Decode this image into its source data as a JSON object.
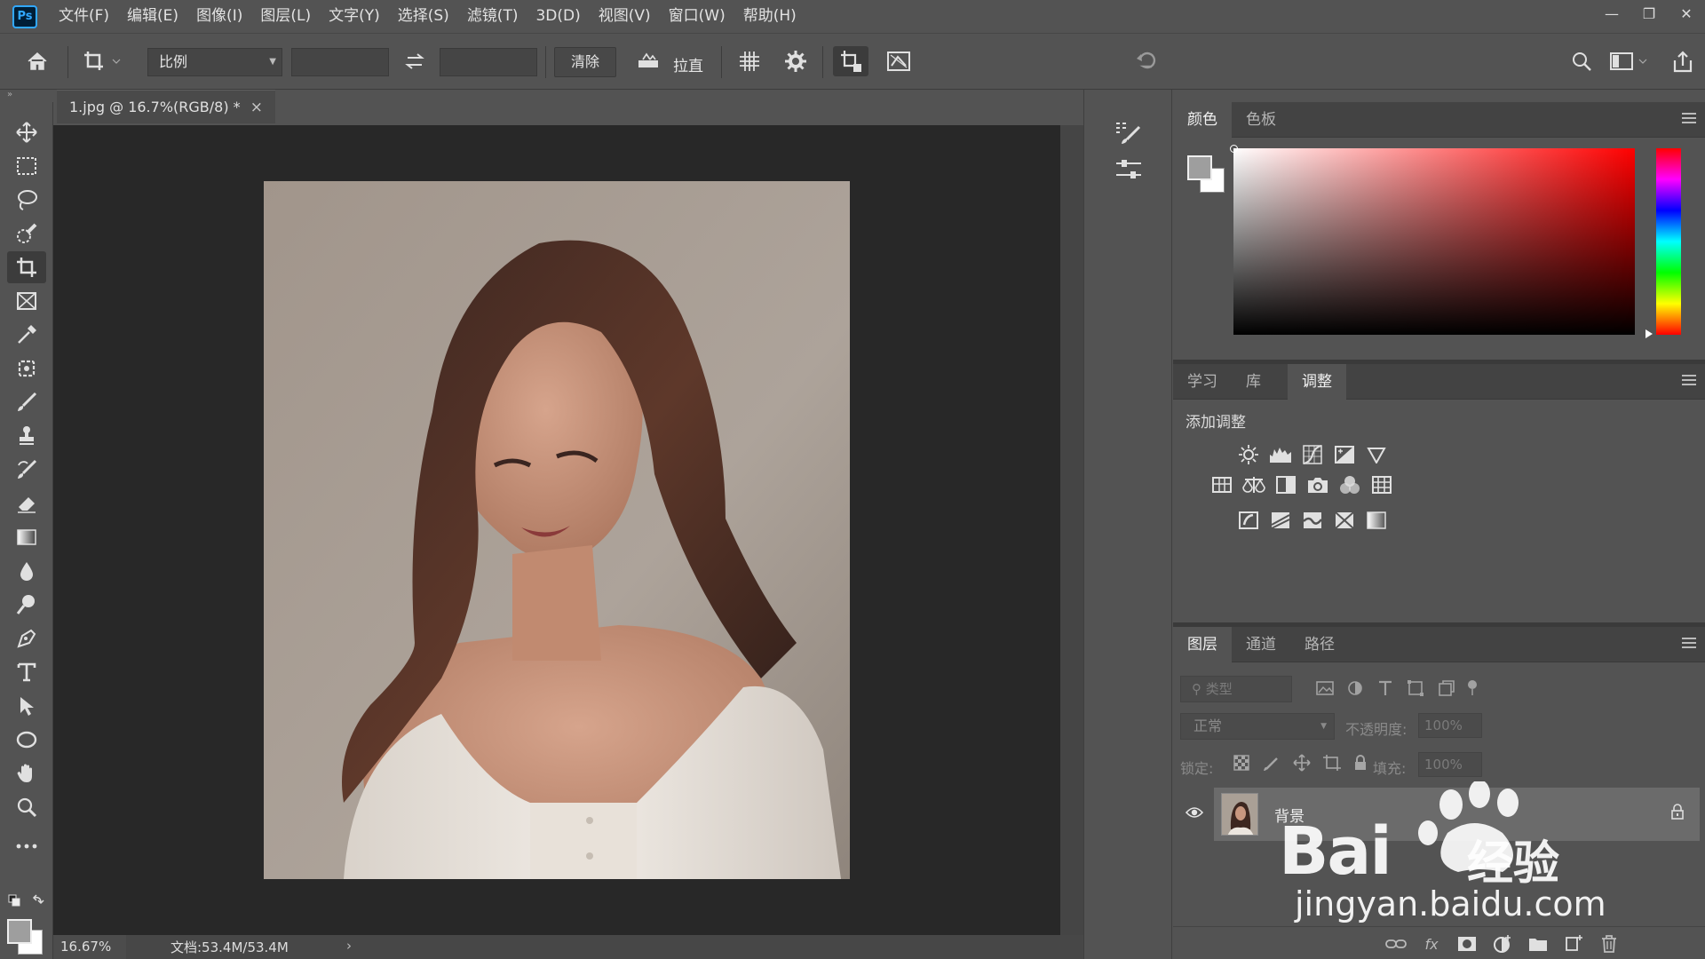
{
  "app": {
    "logo": "Ps"
  },
  "menu": [
    "文件(F)",
    "编辑(E)",
    "图像(I)",
    "图层(L)",
    "文字(Y)",
    "选择(S)",
    "滤镜(T)",
    "3D(D)",
    "视图(V)",
    "窗口(W)",
    "帮助(H)"
  ],
  "options_bar": {
    "ratio_select": "比例",
    "clear_label": "清除",
    "straighten_label": "拉直"
  },
  "document": {
    "tab_title": "1.jpg @ 16.7%(RGB/8) *",
    "zoom": "16.67%",
    "doc_size": "文档:53.4M/53.4M"
  },
  "color_panel": {
    "tabs": [
      "颜色",
      "色板"
    ],
    "active_tab": "颜色",
    "hue": "red",
    "accent": "#ff0000"
  },
  "adjust_panel": {
    "tabs": [
      "学习",
      "库",
      "调整"
    ],
    "active_tab": "调整",
    "title": "添加调整"
  },
  "layers_panel": {
    "tabs": [
      "图层",
      "通道",
      "路径"
    ],
    "active_tab": "图层",
    "filter_placeholder": "类型",
    "blend_mode": "正常",
    "opacity_label": "不透明度:",
    "opacity_value": "100%",
    "lock_label": "锁定:",
    "fill_label": "填充:",
    "fill_value": "100%",
    "layers": [
      {
        "name": "背景",
        "locked": true,
        "visible": true
      }
    ]
  },
  "watermark": {
    "brand": "Bai",
    "brand_suffix": "经验",
    "url": "jingyan.baidu.com"
  }
}
